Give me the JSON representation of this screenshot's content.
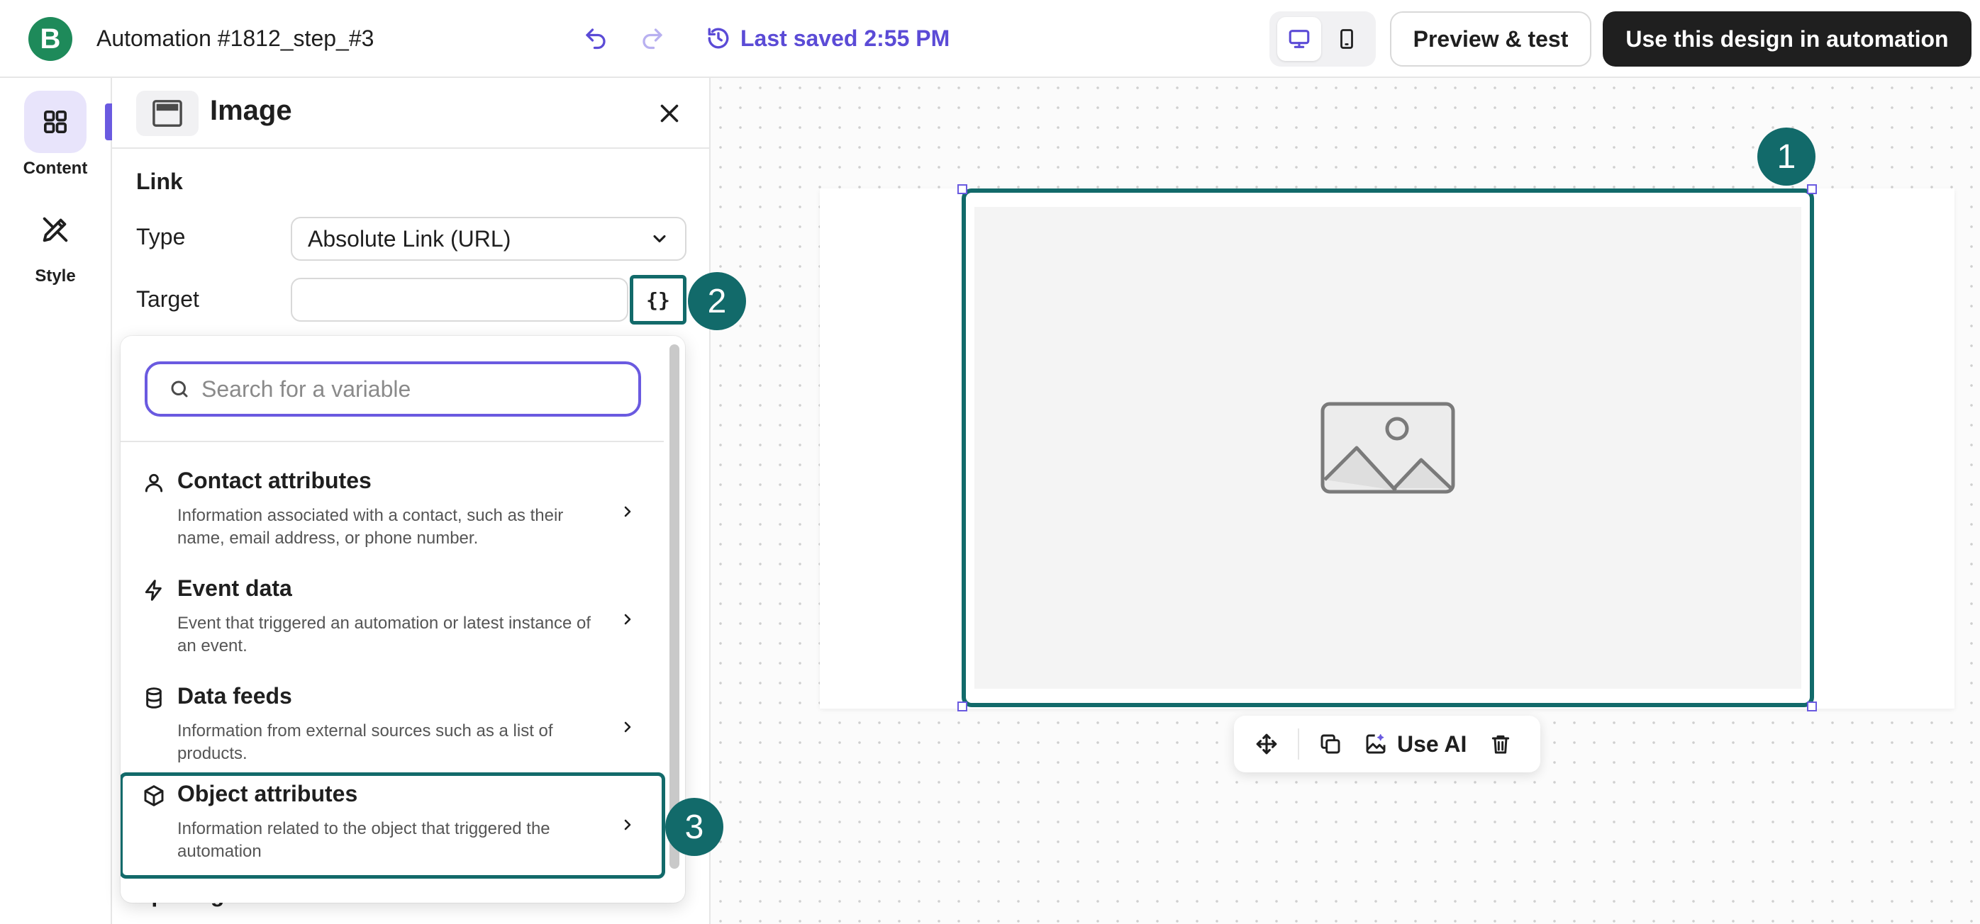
{
  "app": {
    "logo_letter": "B",
    "doc_title": "Automation #1812_step_#3",
    "saved_status": "Last saved 2:55 PM",
    "preview_label": "Preview & test",
    "use_design_label": "Use this design in automation",
    "accent_color": "#6a5ae0",
    "highlight_color": "#126a6a",
    "brand_color": "#1e8a5a"
  },
  "rail": {
    "items": [
      {
        "label": "Content",
        "icon": "grid-icon",
        "active": true
      },
      {
        "label": "Style",
        "icon": "brush-icon",
        "active": false
      }
    ]
  },
  "panel": {
    "title": "Image",
    "section_label": "Link",
    "type_label": "Type",
    "type_value": "Absolute Link (URL)",
    "target_label": "Target",
    "target_value": "",
    "var_button_label": "{}",
    "hidden_section_label": "Spacing"
  },
  "dropdown": {
    "search_placeholder": "Search for a variable",
    "categories": [
      {
        "title": "Contact attributes",
        "desc": "Information associated with a contact, such as their name, email address, or phone number.",
        "icon": "person-icon"
      },
      {
        "title": "Event data",
        "desc": "Event that triggered an automation or latest instance of an event.",
        "icon": "lightning-icon"
      },
      {
        "title": "Data feeds",
        "desc": "Information from external sources such as a list of products.",
        "icon": "database-icon"
      },
      {
        "title": "Object attributes",
        "desc": "Information related to the object that triggered the automation",
        "icon": "cube-icon"
      }
    ]
  },
  "canvas": {
    "toolbar": {
      "use_ai_label": "Use AI"
    }
  },
  "badges": [
    "1",
    "2",
    "3"
  ]
}
